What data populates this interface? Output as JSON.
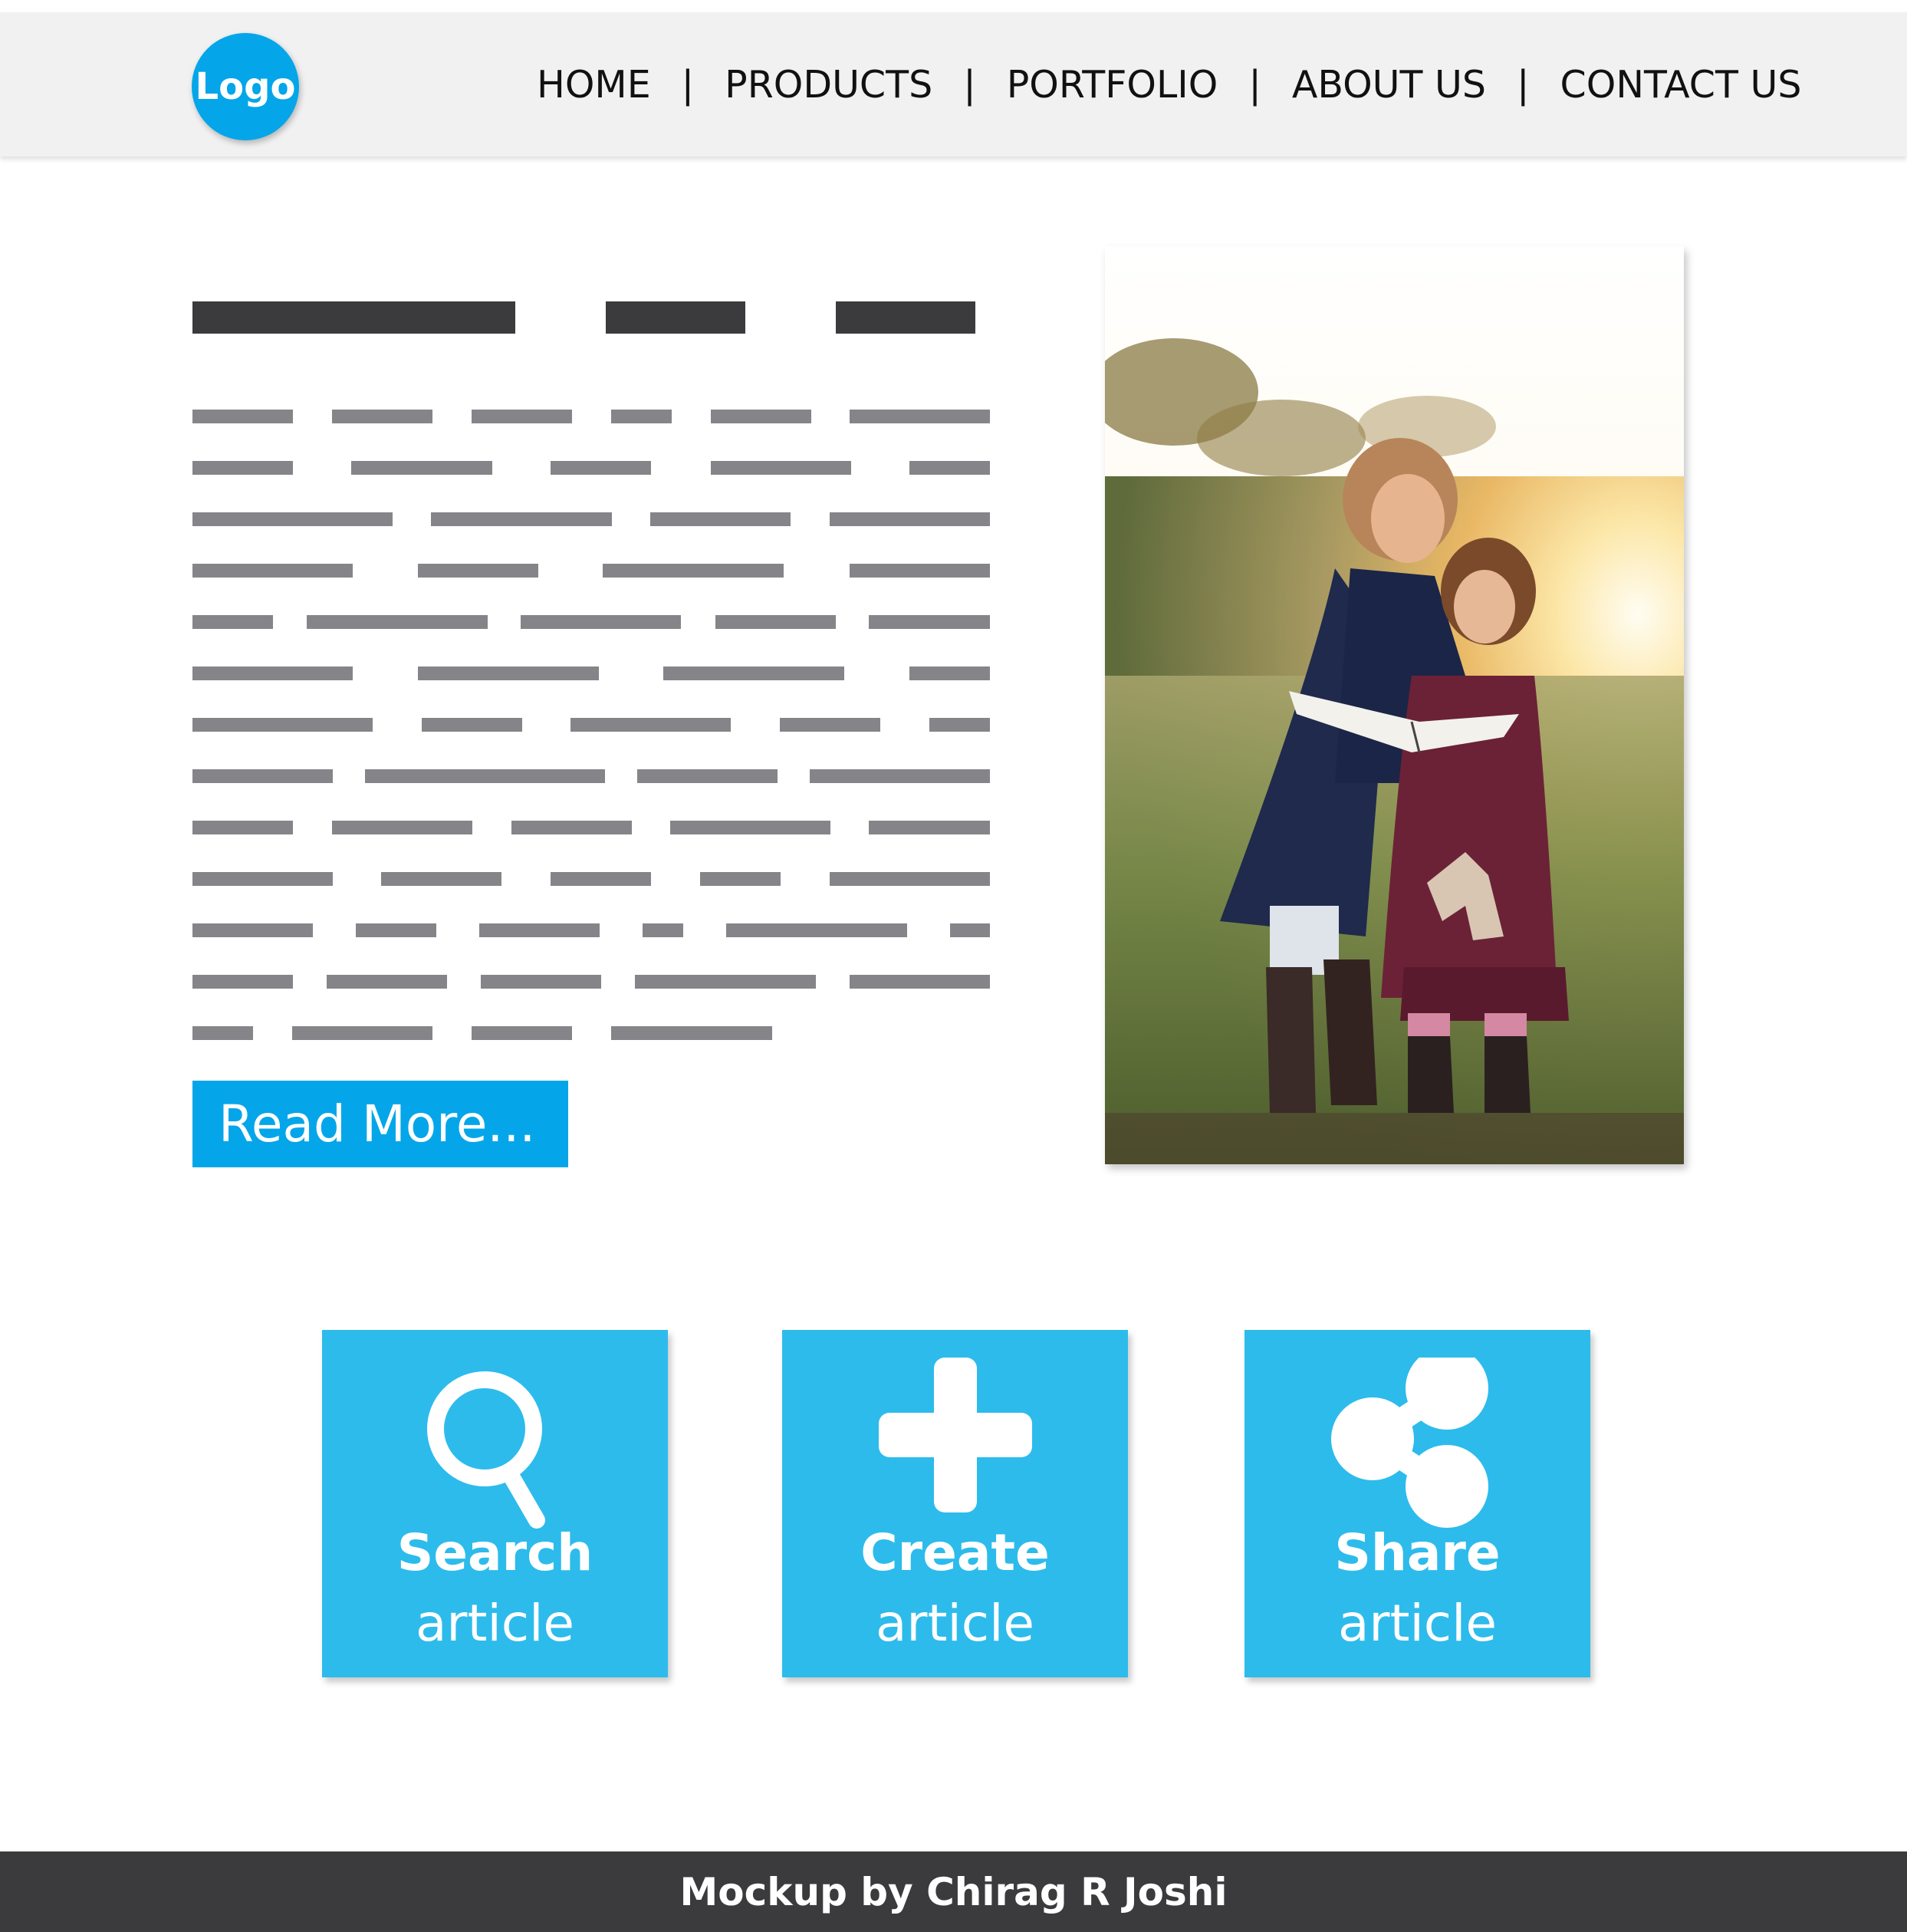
{
  "header": {
    "logo_text": "Logo",
    "nav": [
      {
        "label": "HOME"
      },
      {
        "label": "PRODUCTS"
      },
      {
        "label": "PORTFOLIO"
      },
      {
        "label": "ABOUT US"
      },
      {
        "label": "CONTACT US"
      }
    ],
    "separator": "|"
  },
  "article": {
    "read_more_label": "Read More..."
  },
  "actions": [
    {
      "title": "Search",
      "subtitle": "article",
      "icon": "search-icon"
    },
    {
      "title": "Create",
      "subtitle": "article",
      "icon": "plus-icon"
    },
    {
      "title": "Share",
      "subtitle": "article",
      "icon": "share-icon"
    }
  ],
  "footer": {
    "credit": "Mockup by Chirag R Joshi"
  },
  "colors": {
    "accent": "#04a6e9",
    "tile": "#2dbbec",
    "dark": "#3b3b3d",
    "placeholder_text": "#858589",
    "header_bg": "#f1f1f2"
  }
}
